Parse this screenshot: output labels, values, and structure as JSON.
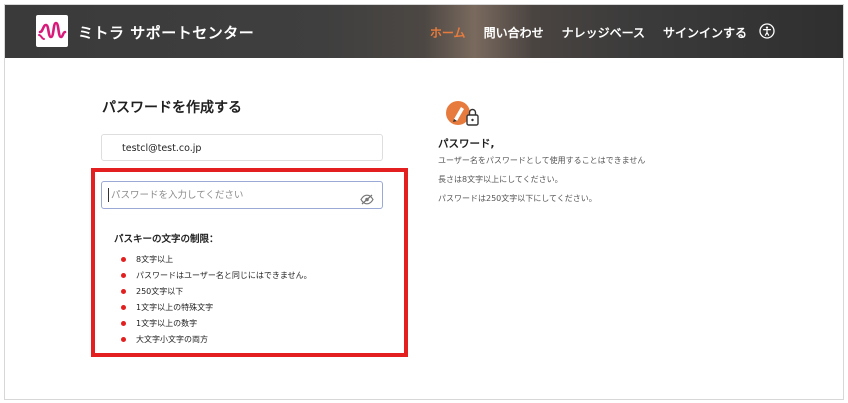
{
  "header": {
    "brand": "ミトラ サポートセンター",
    "nav": [
      {
        "label": "ホーム",
        "active": true
      },
      {
        "label": "問い合わせ",
        "active": false
      },
      {
        "label": "ナレッジベース",
        "active": false
      },
      {
        "label": "サインインする",
        "active": false
      }
    ],
    "accent_color": "#e77b3d",
    "logo_color": "#d81b7a"
  },
  "form": {
    "title": "パスワードを作成する",
    "email_value": "testcl@test.co.jp",
    "password_placeholder": "パスワードを入力してください",
    "rules_title": "パスキーの文字の制限：",
    "rules": [
      "8文字以上",
      "パスワードはユーザー名と同じにはできません。",
      "250文字以下",
      "1文字以上の特殊文字",
      "1文字以上の数字",
      "大文字小文字の両方"
    ],
    "highlight_color": "#e31f1f"
  },
  "info": {
    "title": "パスワード,",
    "lines": [
      "ユーザー名をパスワードとして使用することはできません",
      "長さは8文字以上にしてください。",
      "パスワードは250文字以下にしてください。"
    ]
  }
}
